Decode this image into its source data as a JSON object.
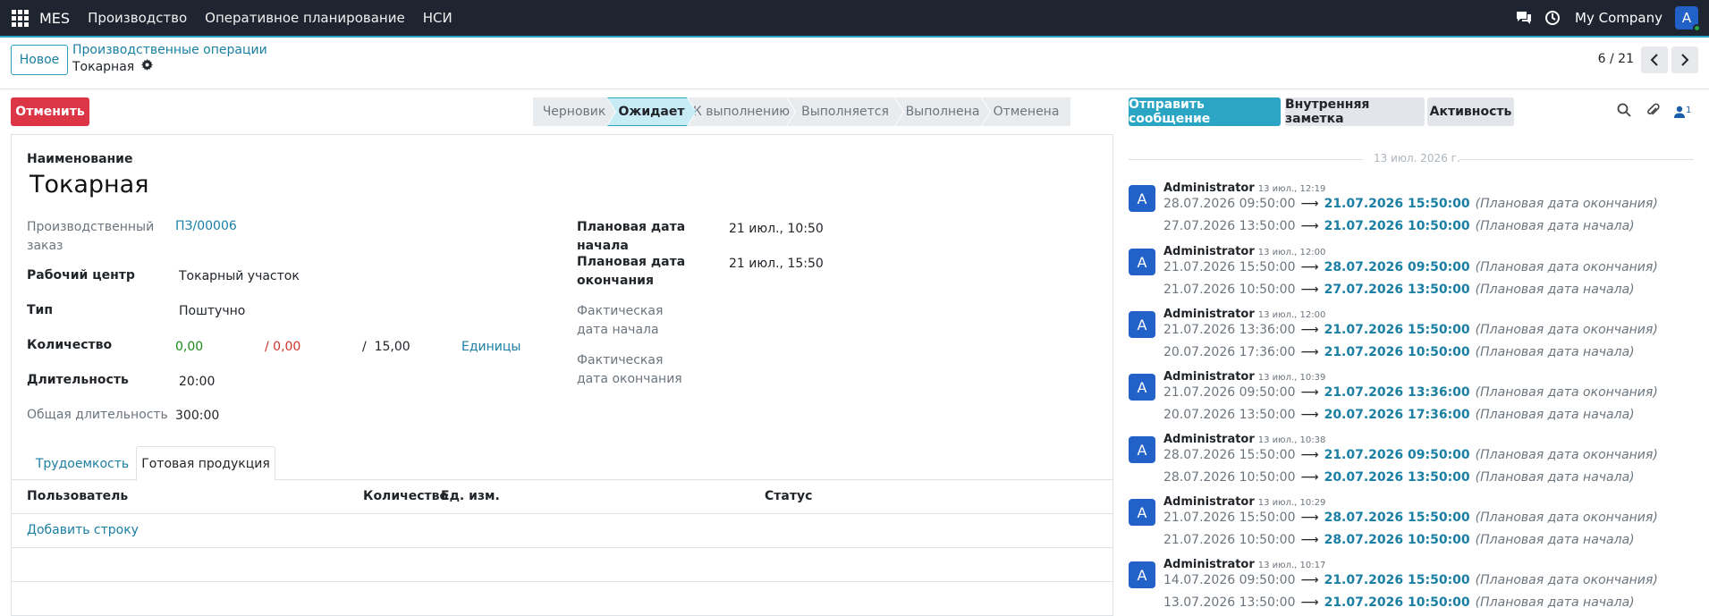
{
  "topbar": {
    "brand": "MES",
    "menu": [
      "Производство",
      "Оперативное планирование",
      "НСИ"
    ],
    "company": "My Company",
    "user_initial": "A"
  },
  "control_panel": {
    "new_button": "Новое",
    "breadcrumb_parent": "Производственные операции",
    "breadcrumb_current": "Токарная",
    "pager": "6 / 21"
  },
  "actions": {
    "cancel_button": "Отменить"
  },
  "statusbar": [
    "Черновик",
    "Ожидает",
    "К выполнению",
    "Выполняется",
    "Выполнена",
    "Отменена"
  ],
  "statusbar_active": "Ожидает",
  "form": {
    "name_label": "Наименование",
    "name_value": "Токарная",
    "production_order_label": "Производственный заказ",
    "production_order_value": "ПЗ/00006",
    "work_center_label": "Рабочий центр",
    "work_center_value": "Токарный участок",
    "type_label": "Тип",
    "type_value": "Поштучно",
    "quantity_label": "Количество",
    "qty_done": "0,00",
    "qty_rejected": "/ 0,00",
    "qty_total": "/  15,00",
    "uom": "Единицы",
    "duration_label": "Длительность",
    "duration_value": "20:00",
    "total_duration_label": "Общая длительность",
    "total_duration_value": "300:00",
    "plan_start_label": "Плановая дата начала",
    "plan_start_value": "21 июл., 10:50",
    "plan_end_label": "Плановая дата окончания",
    "plan_end_value": "21 июл., 15:50",
    "fact_start_label": "Фактическая дата начала",
    "fact_end_label": "Фактическая дата окончания"
  },
  "tabs": [
    "Трудоемкость",
    "Готовая продукция"
  ],
  "table": {
    "columns": [
      "Пользователь",
      "Количество",
      "Ед. изм.",
      "Статус"
    ],
    "add_row": "Добавить строку"
  },
  "chatter": {
    "send_message": "Отправить сообщение",
    "log_note": "Внутренняя заметка",
    "activity": "Активность",
    "followers_count": "1",
    "date_separator": "13 июл. 2026 г.",
    "messages": [
      {
        "author": "Administrator",
        "time": "13 июл., 12:19",
        "changes": [
          {
            "old": "28.07.2026 09:50:00",
            "new": "21.07.2026 15:50:00",
            "field": "(Плановая дата окончания)"
          },
          {
            "old": "27.07.2026 13:50:00",
            "new": "21.07.2026 10:50:00",
            "field": "(Плановая дата начала)"
          }
        ]
      },
      {
        "author": "Administrator",
        "time": "13 июл., 12:00",
        "changes": [
          {
            "old": "21.07.2026 15:50:00",
            "new": "28.07.2026 09:50:00",
            "field": "(Плановая дата окончания)"
          },
          {
            "old": "21.07.2026 10:50:00",
            "new": "27.07.2026 13:50:00",
            "field": "(Плановая дата начала)"
          }
        ]
      },
      {
        "author": "Administrator",
        "time": "13 июл., 12:00",
        "changes": [
          {
            "old": "21.07.2026 13:36:00",
            "new": "21.07.2026 15:50:00",
            "field": "(Плановая дата окончания)"
          },
          {
            "old": "20.07.2026 17:36:00",
            "new": "21.07.2026 10:50:00",
            "field": "(Плановая дата начала)"
          }
        ]
      },
      {
        "author": "Administrator",
        "time": "13 июл., 10:39",
        "changes": [
          {
            "old": "21.07.2026 09:50:00",
            "new": "21.07.2026 13:36:00",
            "field": "(Плановая дата окончания)"
          },
          {
            "old": "20.07.2026 13:50:00",
            "new": "20.07.2026 17:36:00",
            "field": "(Плановая дата начала)"
          }
        ]
      },
      {
        "author": "Administrator",
        "time": "13 июл., 10:38",
        "changes": [
          {
            "old": "28.07.2026 15:50:00",
            "new": "21.07.2026 09:50:00",
            "field": "(Плановая дата окончания)"
          },
          {
            "old": "28.07.2026 10:50:00",
            "new": "20.07.2026 13:50:00",
            "field": "(Плановая дата начала)"
          }
        ]
      },
      {
        "author": "Administrator",
        "time": "13 июл., 10:29",
        "changes": [
          {
            "old": "21.07.2026 15:50:00",
            "new": "28.07.2026 15:50:00",
            "field": "(Плановая дата окончания)"
          },
          {
            "old": "21.07.2026 10:50:00",
            "new": "28.07.2026 10:50:00",
            "field": "(Плановая дата начала)"
          }
        ]
      },
      {
        "author": "Administrator",
        "time": "13 июл., 10:17",
        "changes": [
          {
            "old": "14.07.2026 09:50:00",
            "new": "21.07.2026 15:50:00",
            "field": "(Плановая дата окончания)"
          },
          {
            "old": "13.07.2026 13:50:00",
            "new": "21.07.2026 10:50:00",
            "field": "(Плановая дата начала)"
          }
        ]
      }
    ]
  },
  "colors": {
    "navbar": "#1f2530",
    "primary": "#2aa5c4",
    "link": "#1a7fa3",
    "danger": "#dc3545",
    "avatar": "#2261c8",
    "qty_done": "#1a8a1a",
    "qty_rejected": "#d0342c"
  }
}
